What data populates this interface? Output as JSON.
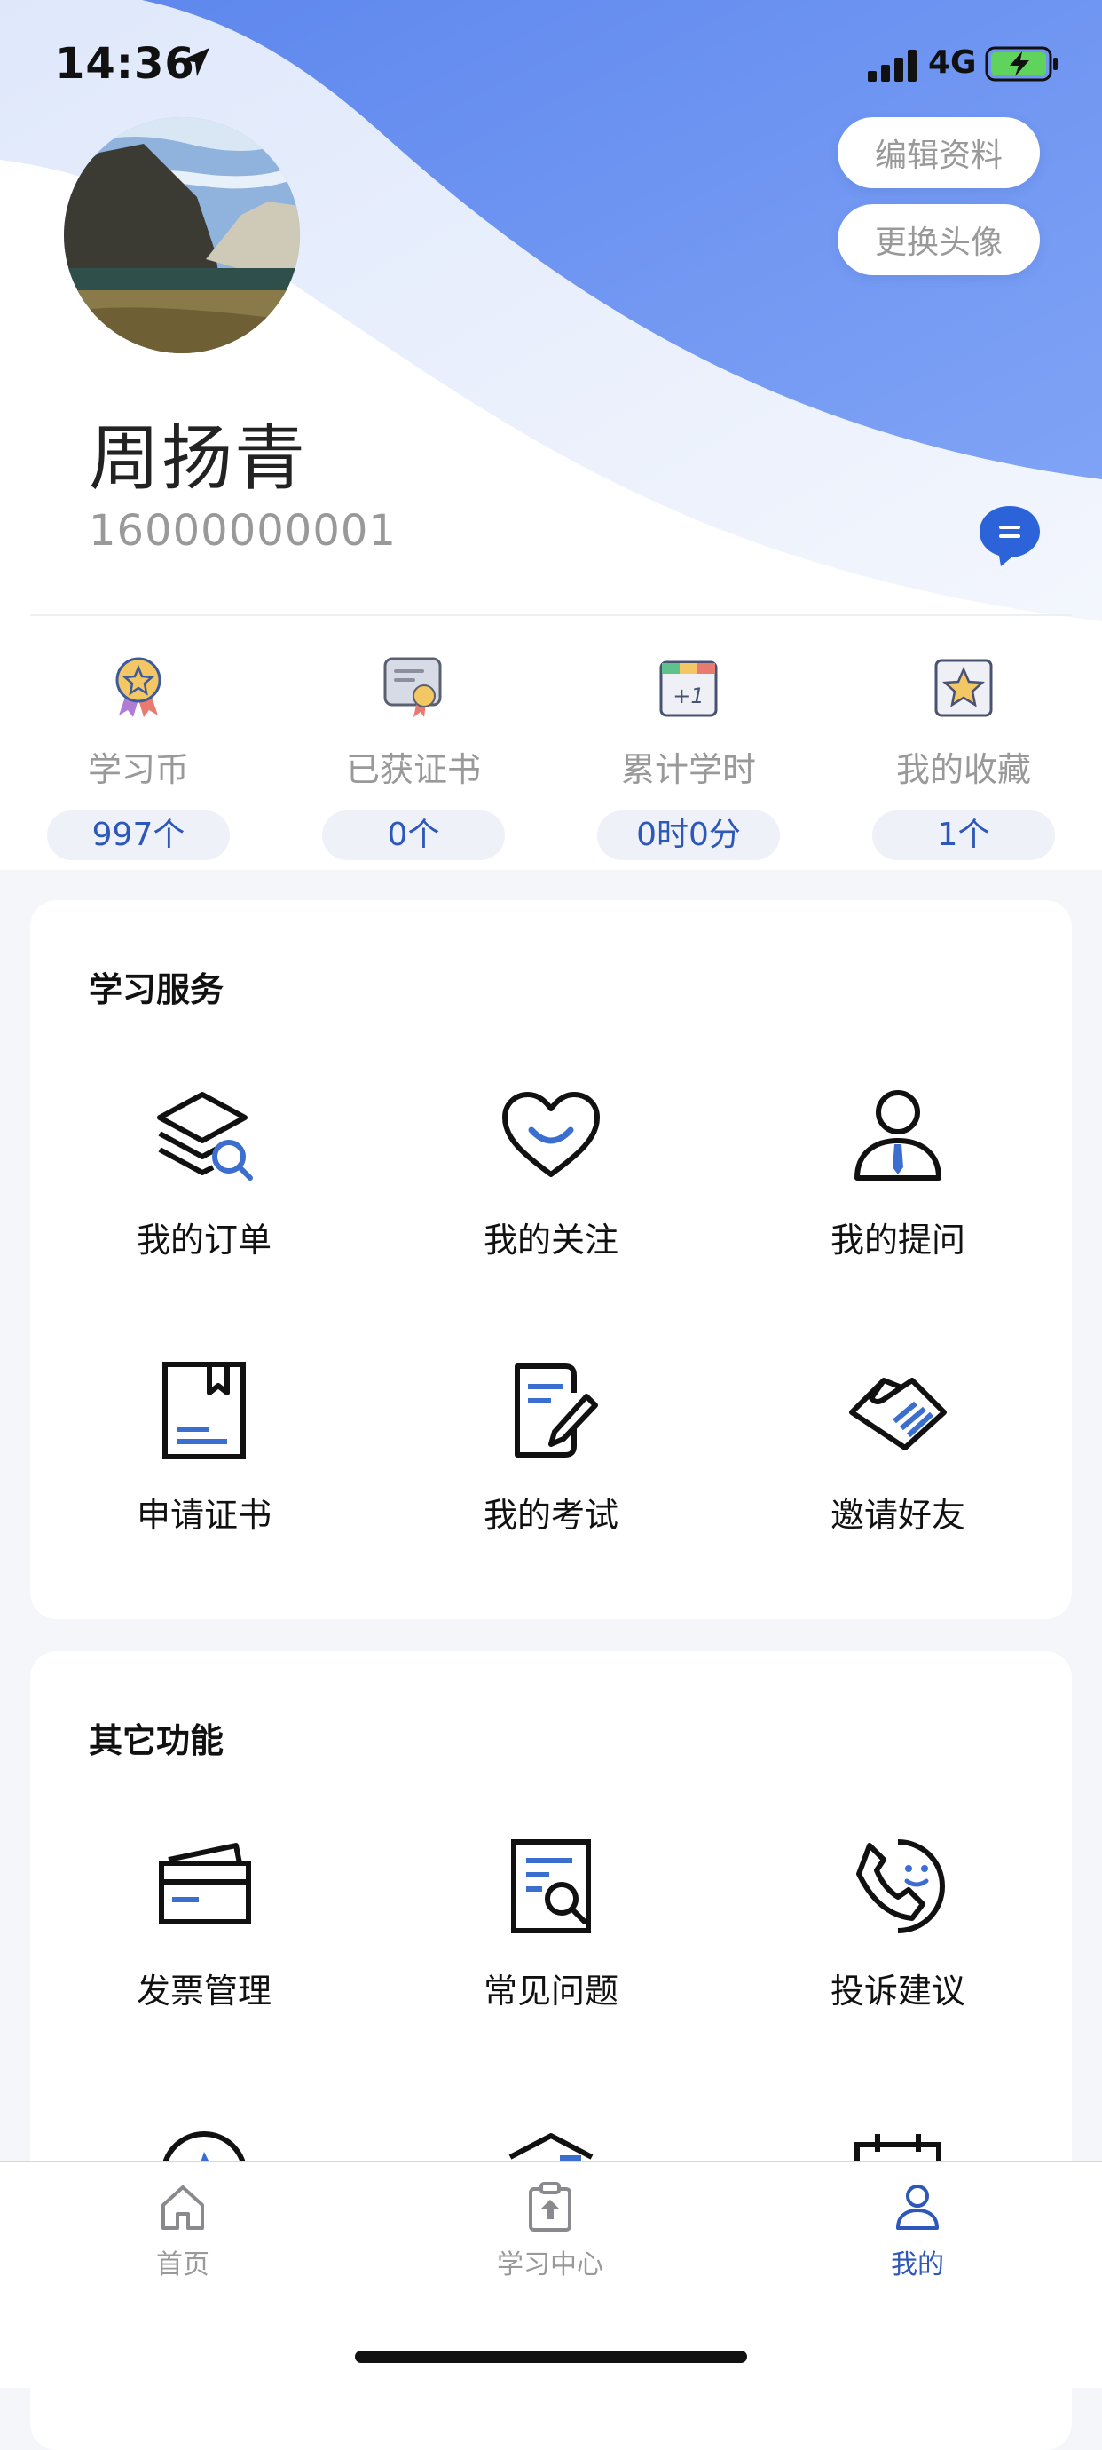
{
  "status_bar": {
    "time": "14:36",
    "network": "4G"
  },
  "profile": {
    "edit_button": "编辑资料",
    "change_avatar_button": "更换头像",
    "name": "周扬青",
    "phone": "16000000001"
  },
  "stats": [
    {
      "label": "学习币",
      "value": "997个",
      "icon": "medal-icon"
    },
    {
      "label": "已获证书",
      "value": "0个",
      "icon": "certificate-icon"
    },
    {
      "label": "累计学时",
      "value": "0时0分",
      "icon": "calendar-plus-one-icon"
    },
    {
      "label": "我的收藏",
      "value": "1个",
      "icon": "star-icon"
    }
  ],
  "study_services": {
    "title": "学习服务",
    "items": [
      {
        "label": "我的订单",
        "icon": "layers-search-icon"
      },
      {
        "label": "我的关注",
        "icon": "heart-icon"
      },
      {
        "label": "我的提问",
        "icon": "person-icon"
      },
      {
        "label": "申请证书",
        "icon": "bookmark-book-icon"
      },
      {
        "label": "我的考试",
        "icon": "document-pen-icon"
      },
      {
        "label": "邀请好友",
        "icon": "handshake-icon"
      }
    ]
  },
  "other_functions": {
    "title": "其它功能",
    "items": [
      {
        "label": "发票管理",
        "icon": "card-icon"
      },
      {
        "label": "常见问题",
        "icon": "document-search-icon"
      },
      {
        "label": "投诉建议",
        "icon": "phone-smile-icon"
      }
    ]
  },
  "tab_bar": {
    "items": [
      {
        "label": "首页",
        "icon": "home-icon",
        "active": false
      },
      {
        "label": "学习中心",
        "icon": "clipboard-upload-icon",
        "active": false
      },
      {
        "label": "我的",
        "icon": "user-icon",
        "active": true
      }
    ]
  },
  "colors": {
    "accent": "#2d57b8",
    "wave": "#6b93f2"
  }
}
